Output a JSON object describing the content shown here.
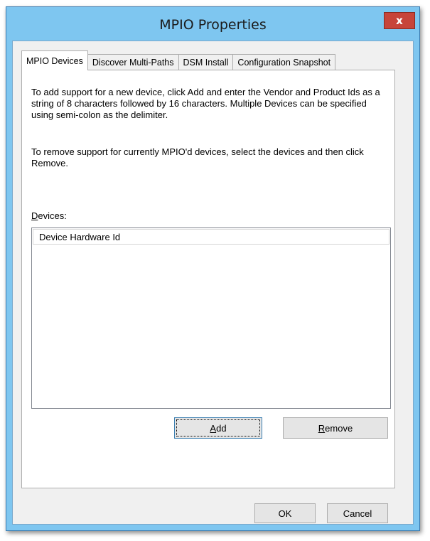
{
  "window": {
    "title": "MPIO Properties",
    "close_label": "x"
  },
  "tabs": [
    {
      "label": "MPIO Devices",
      "active": true
    },
    {
      "label": "Discover Multi-Paths",
      "active": false
    },
    {
      "label": "DSM Install",
      "active": false
    },
    {
      "label": "Configuration Snapshot",
      "active": false
    }
  ],
  "panel": {
    "add_instructions": "To add support for a new device, click Add and enter the Vendor and Product Ids as a string of 8 characters followed by 16 characters. Multiple Devices can be specified using semi-colon as the delimiter.",
    "remove_instructions": "To remove support for currently MPIO'd devices, select the devices and then click Remove.",
    "devices_label_mnemonic": "D",
    "devices_label_rest": "evices:",
    "list_column_header": "Device Hardware Id",
    "devices": [],
    "add_button_mnemonic": "A",
    "add_button_rest": "dd",
    "remove_button_mnemonic": "R",
    "remove_button_rest": "emove"
  },
  "footer": {
    "ok_label": "OK",
    "cancel_label": "Cancel"
  }
}
